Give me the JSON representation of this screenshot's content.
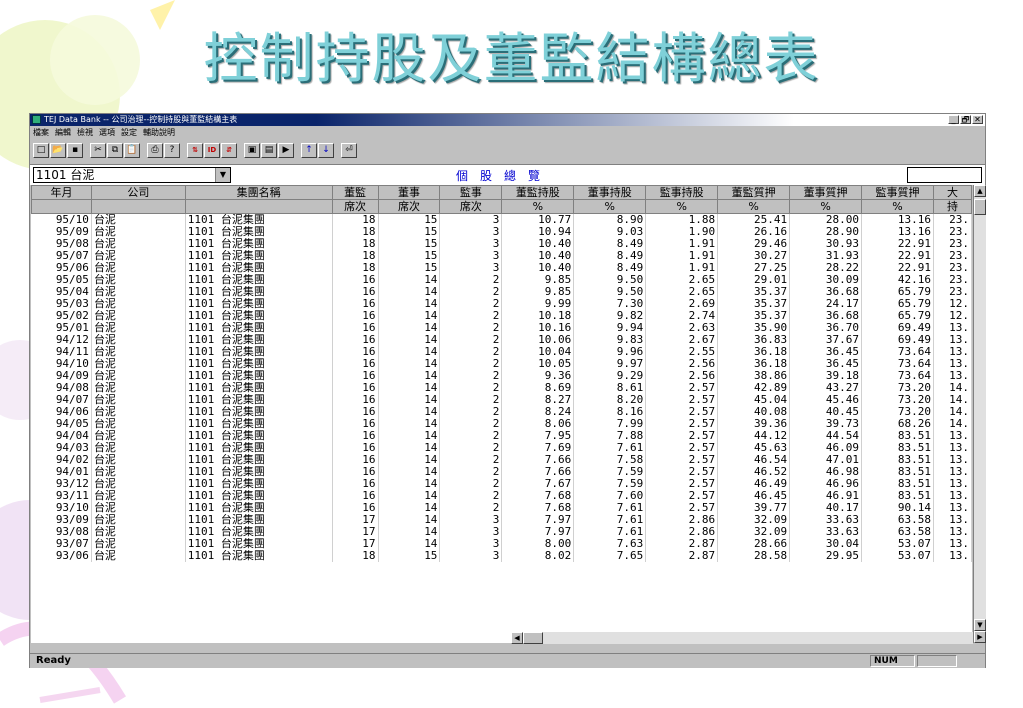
{
  "slide": {
    "title": "控制持股及董監結構總表"
  },
  "window": {
    "title": "TEJ Data Bank -- 公司治理--控制持股與董監結構主表",
    "controls": [
      "_",
      "🗗",
      "✕"
    ]
  },
  "menu": [
    "檔案",
    "編輯",
    "檢視",
    "選項",
    "設定",
    "輔助說明"
  ],
  "toolbar": {
    "buttons": [
      {
        "name": "new-icon",
        "glyph": "□"
      },
      {
        "name": "open-icon",
        "glyph": "📂"
      },
      {
        "name": "save-icon",
        "glyph": "▪"
      },
      {
        "name": "cut-icon",
        "glyph": "✂"
      },
      {
        "name": "copy-icon",
        "glyph": "⧉"
      },
      {
        "name": "paste-icon",
        "glyph": "📋"
      },
      {
        "name": "print-icon",
        "glyph": "⎙"
      },
      {
        "name": "help-icon",
        "glyph": "?"
      },
      {
        "name": "sort-icon",
        "glyph": "⇅"
      },
      {
        "name": "id-icon",
        "glyph": "ID"
      },
      {
        "name": "filter-icon",
        "glyph": "⇵"
      },
      {
        "name": "export-icon",
        "glyph": "▣"
      },
      {
        "name": "export2-icon",
        "glyph": "▤"
      },
      {
        "name": "export3-icon",
        "glyph": "▶"
      },
      {
        "name": "up-arrow-icon",
        "glyph": "↑"
      },
      {
        "name": "down-arrow-icon",
        "glyph": "↓"
      },
      {
        "name": "exit-icon",
        "glyph": "⏎"
      }
    ]
  },
  "selector": {
    "company": "1101 台泥",
    "overview_label": "個股總覽",
    "search_value": ""
  },
  "grid": {
    "headers1": [
      "年月",
      "公司",
      "集團名稱",
      "董監",
      "董事",
      "監事",
      "董監持股",
      "董事持股",
      "監事持股",
      "董監質押",
      "董事質押",
      "監事質押",
      "大"
    ],
    "headers2": [
      "",
      "",
      "",
      "席次",
      "席次",
      "席次",
      "%",
      "%",
      "%",
      "%",
      "%",
      "%",
      "持"
    ],
    "rows": [
      [
        "95/10",
        "台泥",
        "1101  台泥集團",
        "18",
        "15",
        "3",
        "10.77",
        "8.90",
        "1.88",
        "25.41",
        "28.00",
        "13.16",
        "23."
      ],
      [
        "95/09",
        "台泥",
        "1101  台泥集團",
        "18",
        "15",
        "3",
        "10.94",
        "9.03",
        "1.90",
        "26.16",
        "28.90",
        "13.16",
        "23."
      ],
      [
        "95/08",
        "台泥",
        "1101  台泥集團",
        "18",
        "15",
        "3",
        "10.40",
        "8.49",
        "1.91",
        "29.46",
        "30.93",
        "22.91",
        "23."
      ],
      [
        "95/07",
        "台泥",
        "1101  台泥集團",
        "18",
        "15",
        "3",
        "10.40",
        "8.49",
        "1.91",
        "30.27",
        "31.93",
        "22.91",
        "23."
      ],
      [
        "95/06",
        "台泥",
        "1101  台泥集團",
        "18",
        "15",
        "3",
        "10.40",
        "8.49",
        "1.91",
        "27.25",
        "28.22",
        "22.91",
        "23."
      ],
      [
        "95/05",
        "台泥",
        "1101  台泥集團",
        "16",
        "14",
        "2",
        "9.85",
        "9.50",
        "2.65",
        "29.01",
        "30.09",
        "42.16",
        "23."
      ],
      [
        "95/04",
        "台泥",
        "1101  台泥集團",
        "16",
        "14",
        "2",
        "9.85",
        "9.50",
        "2.65",
        "35.37",
        "36.68",
        "65.79",
        "23."
      ],
      [
        "95/03",
        "台泥",
        "1101  台泥集團",
        "16",
        "14",
        "2",
        "9.99",
        "7.30",
        "2.69",
        "35.37",
        "24.17",
        "65.79",
        "12."
      ],
      [
        "95/02",
        "台泥",
        "1101  台泥集團",
        "16",
        "14",
        "2",
        "10.18",
        "9.82",
        "2.74",
        "35.37",
        "36.68",
        "65.79",
        "12."
      ],
      [
        "95/01",
        "台泥",
        "1101  台泥集團",
        "16",
        "14",
        "2",
        "10.16",
        "9.94",
        "2.63",
        "35.90",
        "36.70",
        "69.49",
        "13."
      ],
      [
        "94/12",
        "台泥",
        "1101  台泥集團",
        "16",
        "14",
        "2",
        "10.06",
        "9.83",
        "2.67",
        "36.83",
        "37.67",
        "69.49",
        "13."
      ],
      [
        "94/11",
        "台泥",
        "1101  台泥集團",
        "16",
        "14",
        "2",
        "10.04",
        "9.96",
        "2.55",
        "36.18",
        "36.45",
        "73.64",
        "13."
      ],
      [
        "94/10",
        "台泥",
        "1101  台泥集團",
        "16",
        "14",
        "2",
        "10.05",
        "9.97",
        "2.56",
        "36.18",
        "36.45",
        "73.64",
        "13."
      ],
      [
        "94/09",
        "台泥",
        "1101  台泥集團",
        "16",
        "14",
        "2",
        "9.36",
        "9.29",
        "2.56",
        "38.86",
        "39.18",
        "73.64",
        "13."
      ],
      [
        "94/08",
        "台泥",
        "1101  台泥集團",
        "16",
        "14",
        "2",
        "8.69",
        "8.61",
        "2.57",
        "42.89",
        "43.27",
        "73.20",
        "14."
      ],
      [
        "94/07",
        "台泥",
        "1101  台泥集團",
        "16",
        "14",
        "2",
        "8.27",
        "8.20",
        "2.57",
        "45.04",
        "45.46",
        "73.20",
        "14."
      ],
      [
        "94/06",
        "台泥",
        "1101  台泥集團",
        "16",
        "14",
        "2",
        "8.24",
        "8.16",
        "2.57",
        "40.08",
        "40.45",
        "73.20",
        "14."
      ],
      [
        "94/05",
        "台泥",
        "1101  台泥集團",
        "16",
        "14",
        "2",
        "8.06",
        "7.99",
        "2.57",
        "39.36",
        "39.73",
        "68.26",
        "14."
      ],
      [
        "94/04",
        "台泥",
        "1101  台泥集團",
        "16",
        "14",
        "2",
        "7.95",
        "7.88",
        "2.57",
        "44.12",
        "44.54",
        "83.51",
        "13."
      ],
      [
        "94/03",
        "台泥",
        "1101  台泥集團",
        "16",
        "14",
        "2",
        "7.69",
        "7.61",
        "2.57",
        "45.63",
        "46.09",
        "83.51",
        "13."
      ],
      [
        "94/02",
        "台泥",
        "1101  台泥集團",
        "16",
        "14",
        "2",
        "7.66",
        "7.58",
        "2.57",
        "46.54",
        "47.01",
        "83.51",
        "13."
      ],
      [
        "94/01",
        "台泥",
        "1101  台泥集團",
        "16",
        "14",
        "2",
        "7.66",
        "7.59",
        "2.57",
        "46.52",
        "46.98",
        "83.51",
        "13."
      ],
      [
        "93/12",
        "台泥",
        "1101  台泥集團",
        "16",
        "14",
        "2",
        "7.67",
        "7.59",
        "2.57",
        "46.49",
        "46.96",
        "83.51",
        "13."
      ],
      [
        "93/11",
        "台泥",
        "1101  台泥集團",
        "16",
        "14",
        "2",
        "7.68",
        "7.60",
        "2.57",
        "46.45",
        "46.91",
        "83.51",
        "13."
      ],
      [
        "93/10",
        "台泥",
        "1101  台泥集團",
        "16",
        "14",
        "2",
        "7.68",
        "7.61",
        "2.57",
        "39.77",
        "40.17",
        "90.14",
        "13."
      ],
      [
        "93/09",
        "台泥",
        "1101  台泥集團",
        "17",
        "14",
        "3",
        "7.97",
        "7.61",
        "2.86",
        "32.09",
        "33.63",
        "63.58",
        "13."
      ],
      [
        "93/08",
        "台泥",
        "1101  台泥集團",
        "17",
        "14",
        "3",
        "7.97",
        "7.61",
        "2.86",
        "32.09",
        "33.63",
        "63.58",
        "13."
      ],
      [
        "93/07",
        "台泥",
        "1101  台泥集團",
        "17",
        "14",
        "3",
        "8.00",
        "7.63",
        "2.87",
        "28.66",
        "30.04",
        "53.07",
        "13."
      ],
      [
        "93/06",
        "台泥",
        "1101  台泥集團",
        "18",
        "15",
        "3",
        "8.02",
        "7.65",
        "2.87",
        "28.58",
        "29.95",
        "53.07",
        "13."
      ]
    ]
  },
  "status": {
    "ready": "Ready",
    "num": "NUM"
  },
  "colors": {
    "title_teal": "#7fd0d8",
    "grid_bg": "#ffffff",
    "chrome": "#c0c0c0",
    "overview_blue": "#0000d0"
  }
}
